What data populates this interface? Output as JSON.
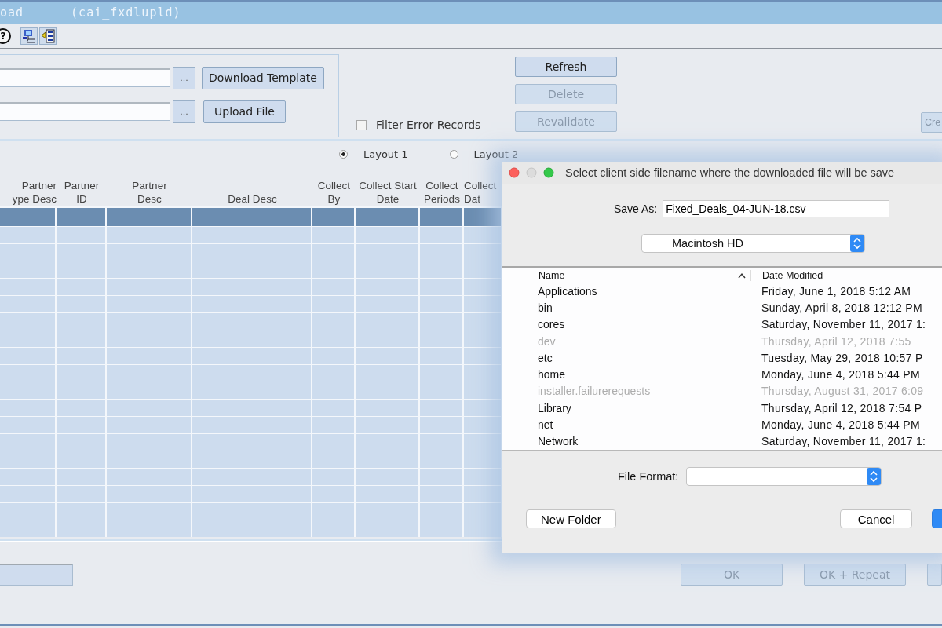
{
  "window": {
    "title": "oad",
    "form_id": "(cai_fxdlupld)"
  },
  "toolbar": [
    {
      "kind": "help",
      "glyph": "?"
    },
    {
      "kind": "network"
    },
    {
      "kind": "list"
    }
  ],
  "upload_panel": {
    "rows": [
      {
        "browse": "...",
        "button": "Download Template"
      },
      {
        "browse": "...",
        "button": "Upload File"
      }
    ],
    "filter": {
      "label": "Filter Error Records",
      "checked": false
    },
    "actions": [
      {
        "label": "Refresh",
        "disabled": false
      },
      {
        "label": "Delete",
        "disabled": true
      },
      {
        "label": "Revalidate",
        "disabled": true
      }
    ],
    "side_button": {
      "label": "Cre",
      "disabled": true
    }
  },
  "layouts": [
    {
      "label": "Layout 1",
      "selected": true
    },
    {
      "label": "Layout 2",
      "selected": false
    }
  ],
  "table": {
    "columns": [
      "Partner\nype Desc",
      "Partner\nID",
      "Partner\nDesc",
      "Deal Desc",
      "Collect\nBy",
      "Collect Start\nDate",
      "Collect\nPeriods",
      "Collect\nDat"
    ],
    "rows": [
      {
        "selected": true
      },
      {
        "selected": false
      },
      {
        "selected": false
      },
      {
        "selected": false
      },
      {
        "selected": false
      },
      {
        "selected": false
      },
      {
        "selected": false
      },
      {
        "selected": false
      },
      {
        "selected": false
      },
      {
        "selected": false
      },
      {
        "selected": false
      },
      {
        "selected": false
      },
      {
        "selected": false
      },
      {
        "selected": false
      },
      {
        "selected": false
      },
      {
        "selected": false
      },
      {
        "selected": false
      },
      {
        "selected": false
      },
      {
        "selected": false
      }
    ]
  },
  "footer": {
    "buttons": [
      {
        "label": "OK",
        "disabled": true
      },
      {
        "label": "OK + Repeat",
        "disabled": true
      },
      {
        "disabled": true
      }
    ]
  },
  "dialog": {
    "title": "Select client side filename where the downloaded file will be save",
    "save_as": {
      "label": "Save As:",
      "value": "Fixed_Deals_04-JUN-18.csv"
    },
    "location": "Macintosh HD",
    "columns": {
      "name": "Name",
      "date": "Date Modified"
    },
    "files": [
      {
        "name": "Applications",
        "date": "Friday, June 1, 2018 5:12 AM",
        "disabled": false
      },
      {
        "name": "bin",
        "date": "Sunday, April 8, 2018 12:12 PM",
        "disabled": false
      },
      {
        "name": "cores",
        "date": "Saturday, November 11, 2017 1:",
        "disabled": false
      },
      {
        "name": "dev",
        "date": "Thursday, April 12, 2018 7:55",
        "disabled": true
      },
      {
        "name": "etc",
        "date": "Tuesday, May 29, 2018 10:57 P",
        "disabled": false
      },
      {
        "name": "home",
        "date": "Monday, June 4, 2018 5:44 PM",
        "disabled": false
      },
      {
        "name": "installer.failurerequests",
        "date": "Thursday, August 31, 2017 6:09",
        "disabled": true
      },
      {
        "name": "Library",
        "date": "Thursday, April 12, 2018 7:54 P",
        "disabled": false
      },
      {
        "name": "net",
        "date": "Monday, June 4, 2018 5:44 PM",
        "disabled": false
      },
      {
        "name": "Network",
        "date": "Saturday, November 11, 2017 1:",
        "disabled": false
      }
    ],
    "file_format": {
      "label": "File Format:"
    },
    "buttons": [
      {
        "kind": "plain",
        "label": "New Folder"
      },
      {
        "kind": "plain",
        "label": "Cancel"
      },
      {
        "kind": "default"
      }
    ]
  }
}
